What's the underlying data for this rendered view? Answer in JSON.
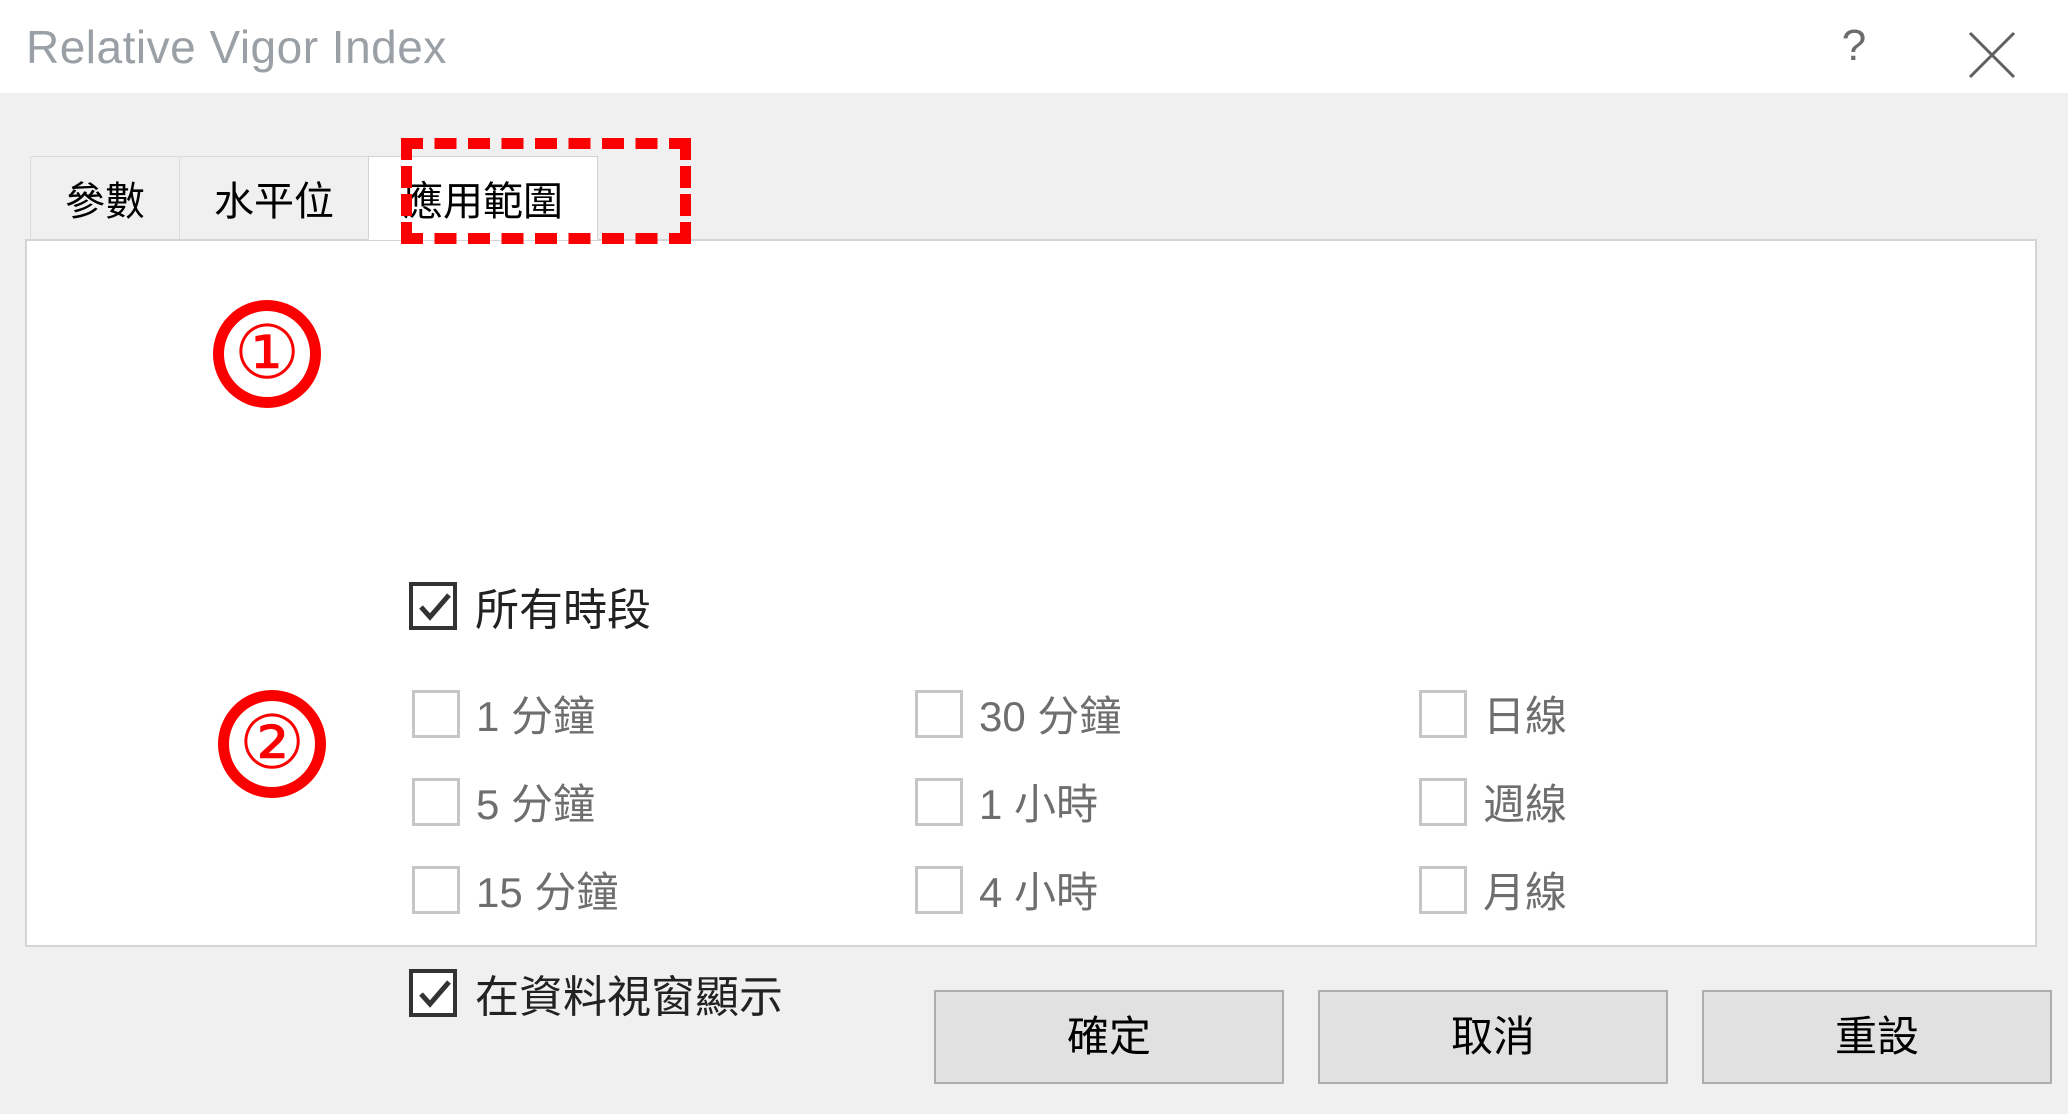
{
  "window": {
    "title": "Relative Vigor Index",
    "help_label": "?",
    "close_icon": "close-icon",
    "help_icon": "help-icon"
  },
  "tabs": [
    {
      "label": "參數",
      "active": false
    },
    {
      "label": "水平位",
      "active": false
    },
    {
      "label": "應用範圍",
      "active": true
    }
  ],
  "content": {
    "all_timeframes": {
      "label": "所有時段",
      "checked": true,
      "enabled": true
    },
    "timeframes": [
      {
        "label": "1 分鐘",
        "checked": false,
        "enabled": false
      },
      {
        "label": "5 分鐘",
        "checked": false,
        "enabled": false
      },
      {
        "label": "15 分鐘",
        "checked": false,
        "enabled": false
      },
      {
        "label": "30 分鐘",
        "checked": false,
        "enabled": false
      },
      {
        "label": "1 小時",
        "checked": false,
        "enabled": false
      },
      {
        "label": "4 小時",
        "checked": false,
        "enabled": false
      },
      {
        "label": "日線",
        "checked": false,
        "enabled": false
      },
      {
        "label": "週線",
        "checked": false,
        "enabled": false
      },
      {
        "label": "月線",
        "checked": false,
        "enabled": false
      }
    ],
    "show_in_data_window": {
      "label": "在資料視窗顯示",
      "checked": true,
      "enabled": true
    }
  },
  "annotations": {
    "marker_1": "①",
    "marker_2": "②",
    "color": "#fb0000"
  },
  "buttons": {
    "ok": "確定",
    "cancel": "取消",
    "reset": "重設"
  },
  "colors": {
    "titlebar_bg": "#ffffff",
    "dialog_bg": "#f0f0f0",
    "panel_bg": "#ffffff",
    "title_text": "#9aa0a6",
    "button_bg": "#e1e1e1",
    "annotation_red": "#fb0000"
  }
}
